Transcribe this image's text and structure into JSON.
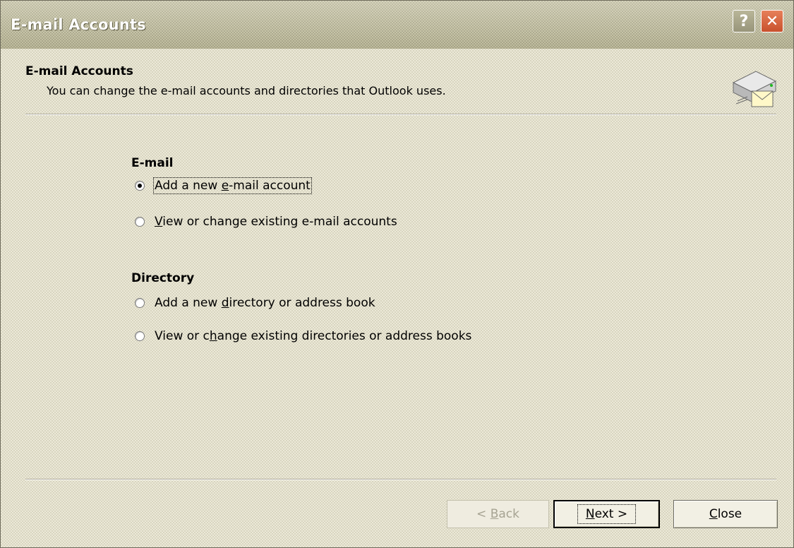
{
  "window": {
    "title": "E-mail Accounts",
    "help_glyph": "?",
    "close_glyph": "✕"
  },
  "header": {
    "title": "E-mail Accounts",
    "subtitle": "You can change the e-mail accounts and directories that Outlook uses.",
    "icon": "email-server-icon"
  },
  "email_group": {
    "label": "E-mail",
    "options": [
      {
        "pre": "Add a new ",
        "key": "e",
        "post": "-mail account",
        "checked": true
      },
      {
        "pre": "",
        "key": "V",
        "post": "iew or change existing e-mail accounts",
        "checked": false
      }
    ]
  },
  "directory_group": {
    "label": "Directory",
    "options": [
      {
        "pre": "Add a new ",
        "key": "d",
        "post": "irectory or address book",
        "checked": false
      },
      {
        "pre": "View or c",
        "key": "h",
        "post": "ange existing directories or address books",
        "checked": false
      }
    ]
  },
  "buttons": {
    "back": {
      "pre": "< ",
      "key": "B",
      "post": "ack",
      "enabled": false
    },
    "next": {
      "pre": "",
      "key": "N",
      "post": "ext >",
      "enabled": true
    },
    "close": {
      "pre": "",
      "key": "C",
      "post": "lose",
      "enabled": true
    }
  }
}
